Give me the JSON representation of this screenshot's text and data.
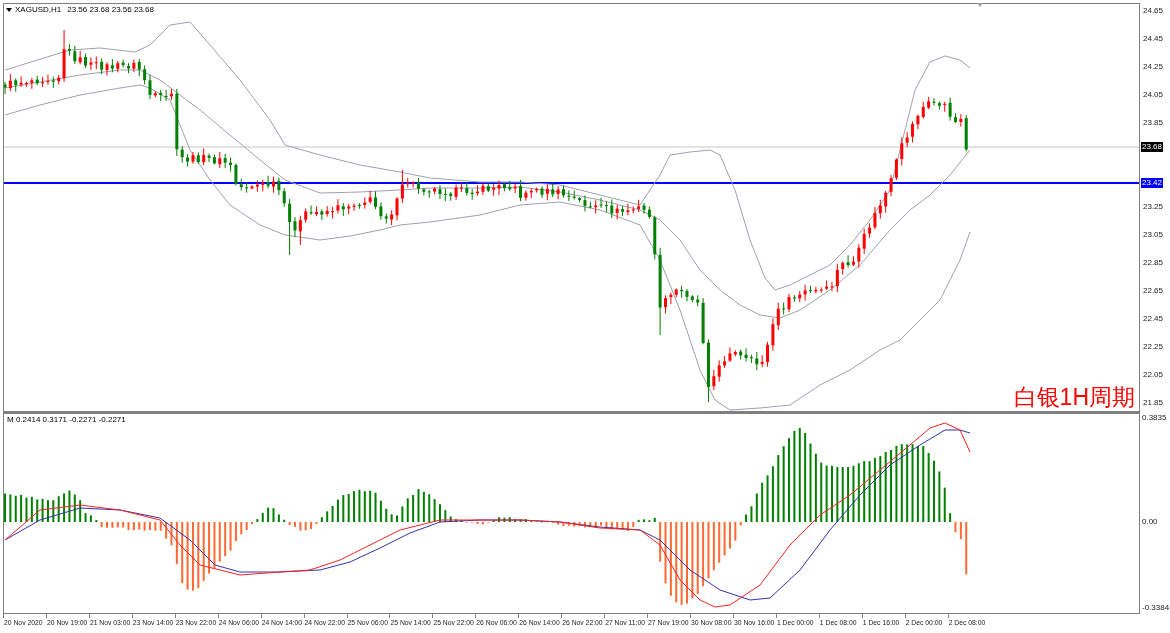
{
  "chart_header": {
    "symbol": "XAGUSD,H1",
    "ohlc": "23.56 23.68 23.56 23.68"
  },
  "price_axis": {
    "labels": [
      {
        "kind": "tick",
        "text": "24.65"
      },
      {
        "kind": "tick",
        "text": "24.45"
      },
      {
        "kind": "tick",
        "text": "24.25"
      },
      {
        "kind": "tick",
        "text": "24.05"
      },
      {
        "kind": "tick",
        "text": "23.85"
      },
      {
        "kind": "bid",
        "text": "23.68"
      },
      {
        "kind": "level",
        "text": "23.42"
      },
      {
        "kind": "tick",
        "text": "23.25"
      },
      {
        "kind": "tick",
        "text": "23.05"
      },
      {
        "kind": "tick",
        "text": "22.85"
      },
      {
        "kind": "tick",
        "text": "22.65"
      },
      {
        "kind": "tick",
        "text": "22.45"
      },
      {
        "kind": "tick",
        "text": "22.25"
      },
      {
        "kind": "tick",
        "text": "22.05"
      },
      {
        "kind": "tick",
        "text": "21.85"
      }
    ]
  },
  "annotation": {
    "text": "白银1H周期"
  },
  "indicator": {
    "label": "M 0.2414 0.3171 -0.2271 -0.2271",
    "axis_labels": [
      "0.3835",
      "0.00",
      "-0.3384"
    ]
  },
  "time_axis": {
    "labels": [
      "20 Nov 2020",
      "20 Nov 19:00",
      "21 Nov 03:00",
      "23 Nov 14:00",
      "23 Nov 22:00",
      "24 Nov 06:00",
      "24 Nov 14:00",
      "24 Nov 22:00",
      "25 Nov 06:00",
      "25 Nov 14:00",
      "25 Nov 22:00",
      "26 Nov 06:00",
      "26 Nov 14:00",
      "26 Nov 22:00",
      "27 Nov 11:00",
      "27 Nov 19:00",
      "30 Nov 08:00",
      "30 Nov 16:00",
      "1 Dec 00:00",
      "1 Dec 08:00",
      "1 Dec 16:00",
      "2 Dec 00:00",
      "2 Dec 08:00"
    ]
  }
}
